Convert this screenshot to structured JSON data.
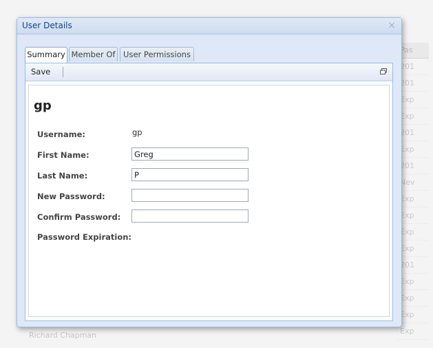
{
  "background": {
    "column_header": "Pas",
    "cells": [
      "201",
      "201",
      "Exp",
      "Exp",
      "201",
      "Exp",
      "201",
      "Nev",
      "Exp",
      "Exp",
      "Exp",
      "Exp",
      "201",
      "Exp",
      "Exp",
      "Exp",
      "Exp"
    ],
    "footer_text": "Richard Chapman"
  },
  "dialog": {
    "title": "User Details",
    "close_symbol": "×"
  },
  "tabs": [
    {
      "label": "Summary",
      "active": true
    },
    {
      "label": "Member Of",
      "active": false
    },
    {
      "label": "User Permissions",
      "active": false
    }
  ],
  "toolbar": {
    "save_label": "Save"
  },
  "form": {
    "title": "gp",
    "username_label": "Username:",
    "username_value": "gp",
    "first_name_label": "First Name:",
    "first_name_value": "Greg",
    "last_name_label": "Last Name:",
    "last_name_value": "P",
    "new_password_label": "New Password:",
    "new_password_value": "",
    "confirm_password_label": "Confirm Password:",
    "confirm_password_value": "",
    "password_expiration_label": "Password Expiration:"
  }
}
